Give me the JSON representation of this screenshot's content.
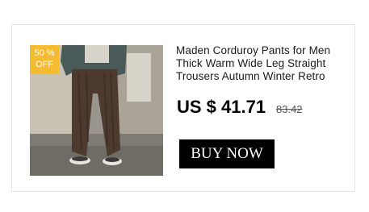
{
  "product": {
    "title": "Maden Corduroy Pants for Men Thick Warm Wide Leg Straight Trousers Autumn Winter Retro",
    "price": "US $ 41.71",
    "original_price": "83.42",
    "discount_badge": {
      "percent": "50 %",
      "label": "OFF",
      "color": "#f6bb2f"
    },
    "image_icon": "product-photo-corduroy-pants"
  },
  "actions": {
    "buy_label": "BUY NOW"
  }
}
